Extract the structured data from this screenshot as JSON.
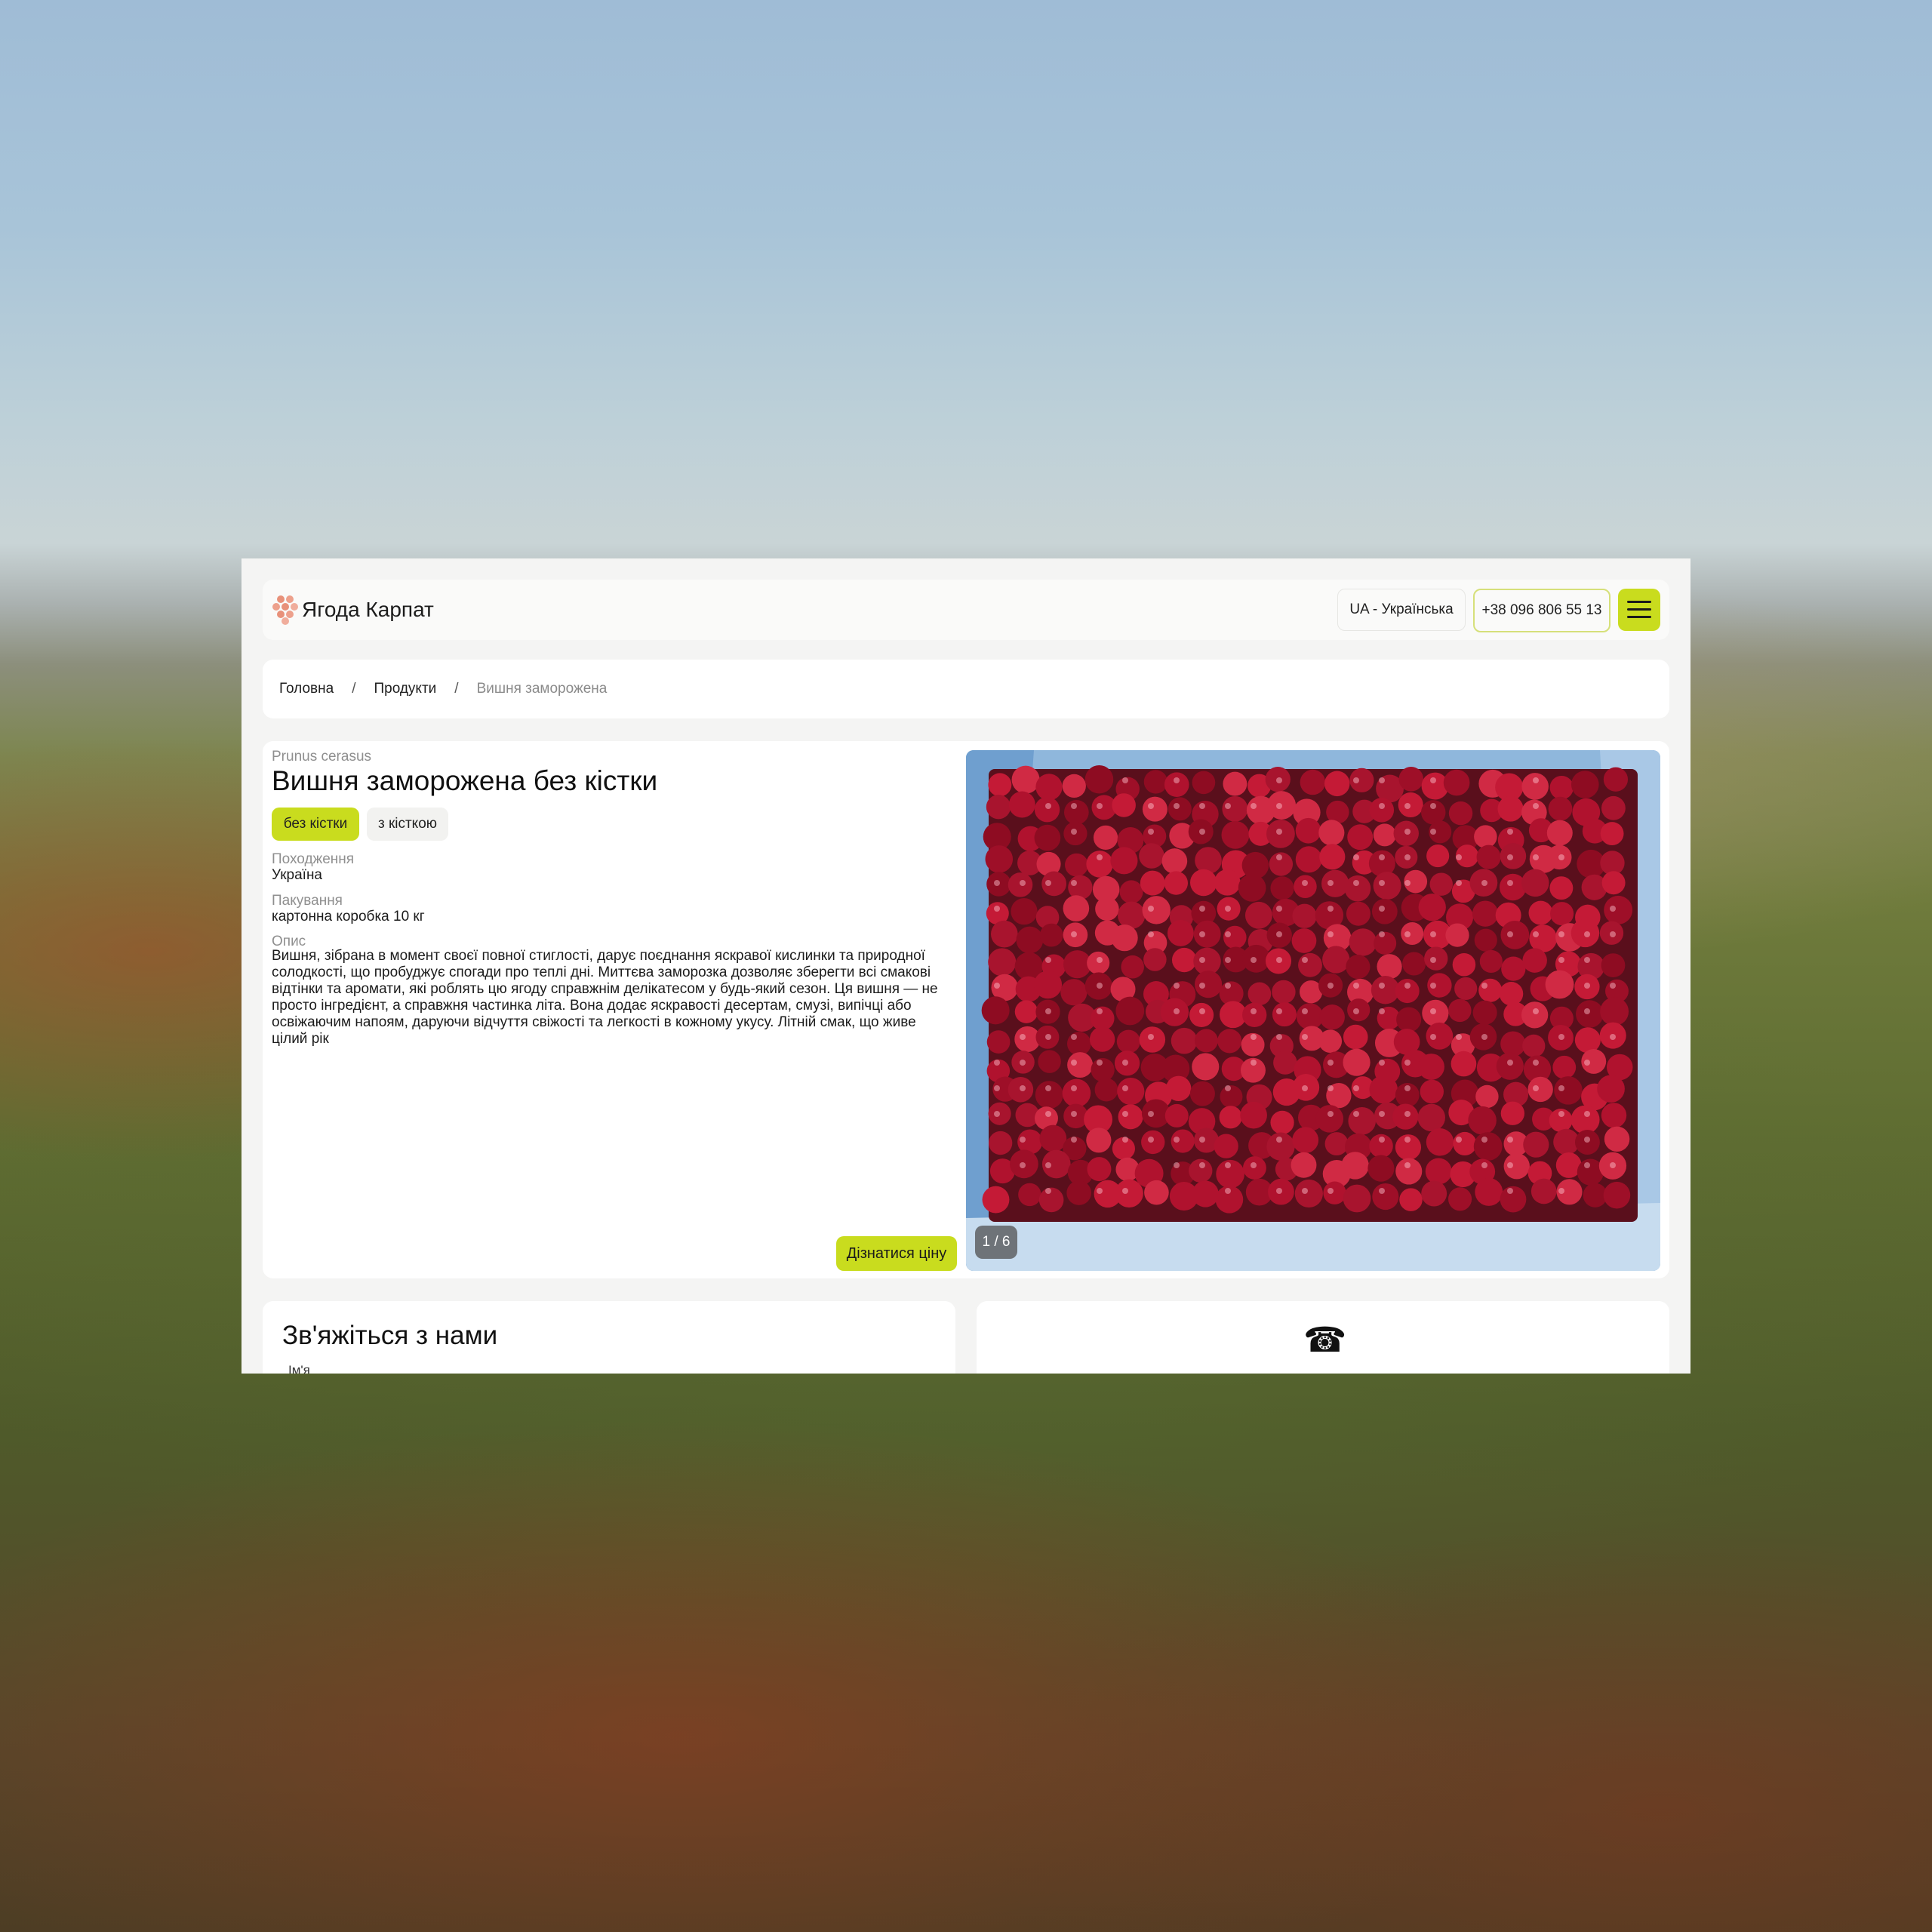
{
  "header": {
    "logo_text": "Ягода Карпат",
    "language": "UA - Українська",
    "phone": "+38 096 806 55 13",
    "colors": {
      "accent": "#c9dc1e",
      "logo": "#e8917a"
    }
  },
  "breadcrumbs": {
    "home": "Головна",
    "products": "Продукти",
    "current": "Вишня заморожена",
    "separator": "/"
  },
  "product": {
    "latin_name": "Prunus cerasus",
    "title": "Вишня заморожена без кістки",
    "variants": [
      {
        "label": "без кістки",
        "selected": true
      },
      {
        "label": "з кісткою",
        "selected": false
      }
    ],
    "origin_label": "Походження",
    "origin_value": "Україна",
    "packaging_label": "Пакування",
    "packaging_value": "картонна коробка 10 кг",
    "description_label": "Опис",
    "description": "Вишня, зібрана в момент своєї повної стиглості, дарує поєднання яскравої кислинки та природної солодкості, що пробуджує спогади про теплі дні. Миттєва заморозка дозволяє зберегти всі смакові відтінки та аромати, які роблять цю ягоду справжнім делікатесом у будь-який сезон. Ця вишня — не просто інгредієнт, а справжня частинка літа. Вона додає яскравості десертам, смузі, випічці або освіжаючим напоям, даруючи відчуття свіжості та легкості в кожному укусу. Літній смак, що живе цілий рік",
    "price_button": "Дізнатися ціну",
    "image_counter": "1 / 6"
  },
  "contact": {
    "title": "Зв'яжіться з нами",
    "name_label": "Ім'я",
    "phone_icon": "phone-icon"
  }
}
